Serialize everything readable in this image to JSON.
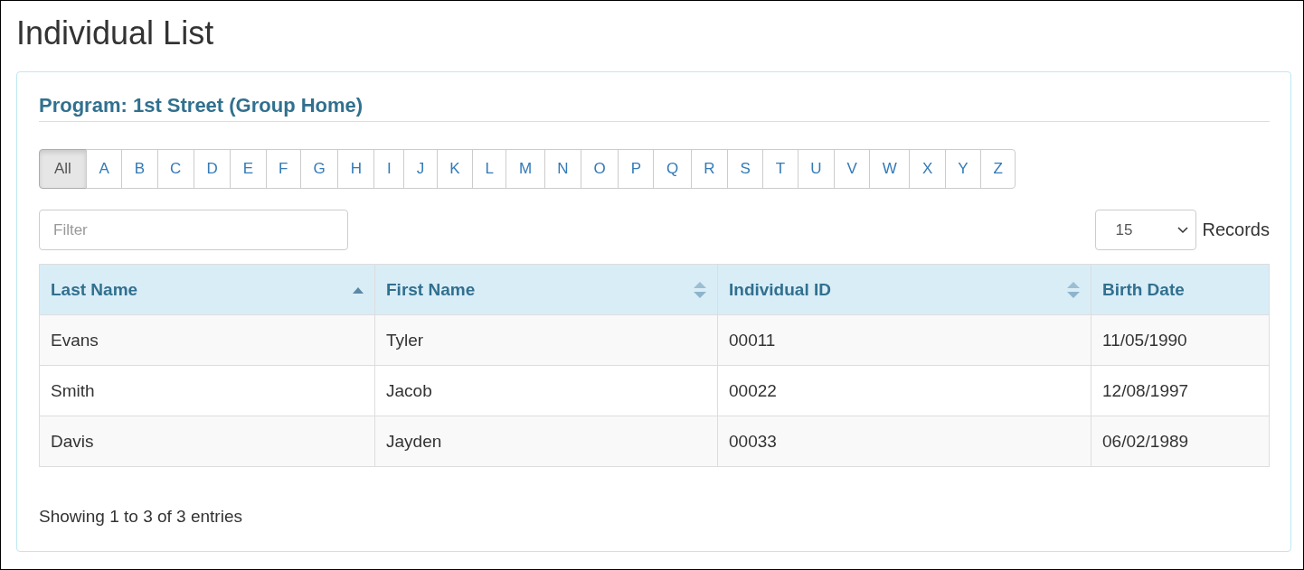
{
  "page_title": "Individual List",
  "panel": {
    "heading": "Program: 1st Street (Group Home)",
    "letters": [
      {
        "label": "All",
        "selected": true
      },
      {
        "label": "A",
        "selected": false
      },
      {
        "label": "B",
        "selected": false
      },
      {
        "label": "C",
        "selected": false
      },
      {
        "label": "D",
        "selected": false
      },
      {
        "label": "E",
        "selected": false
      },
      {
        "label": "F",
        "selected": false
      },
      {
        "label": "G",
        "selected": false
      },
      {
        "label": "H",
        "selected": false
      },
      {
        "label": "I",
        "selected": false
      },
      {
        "label": "J",
        "selected": false
      },
      {
        "label": "K",
        "selected": false
      },
      {
        "label": "L",
        "selected": false
      },
      {
        "label": "M",
        "selected": false
      },
      {
        "label": "N",
        "selected": false
      },
      {
        "label": "O",
        "selected": false
      },
      {
        "label": "P",
        "selected": false
      },
      {
        "label": "Q",
        "selected": false
      },
      {
        "label": "R",
        "selected": false
      },
      {
        "label": "S",
        "selected": false
      },
      {
        "label": "T",
        "selected": false
      },
      {
        "label": "U",
        "selected": false
      },
      {
        "label": "V",
        "selected": false
      },
      {
        "label": "W",
        "selected": false
      },
      {
        "label": "X",
        "selected": false
      },
      {
        "label": "Y",
        "selected": false
      },
      {
        "label": "Z",
        "selected": false
      }
    ],
    "filter": {
      "placeholder": "Filter"
    },
    "page_size": {
      "value": "15",
      "label": "Records"
    },
    "table": {
      "columns": [
        {
          "label": "Last Name",
          "kind": "sorted"
        },
        {
          "label": "First Name",
          "kind": "sortable"
        },
        {
          "label": "Individual ID",
          "kind": "sortable"
        },
        {
          "label": "Birth Date",
          "kind": "plain"
        }
      ],
      "rows": [
        [
          "Evans",
          "Tyler",
          "00011",
          "11/05/1990"
        ],
        [
          "Smith",
          "Jacob",
          "00022",
          "12/08/1997"
        ],
        [
          "Davis",
          "Jayden",
          "00033",
          "06/02/1989"
        ]
      ]
    },
    "info": "Showing 1 to 3 of 3 entries"
  }
}
